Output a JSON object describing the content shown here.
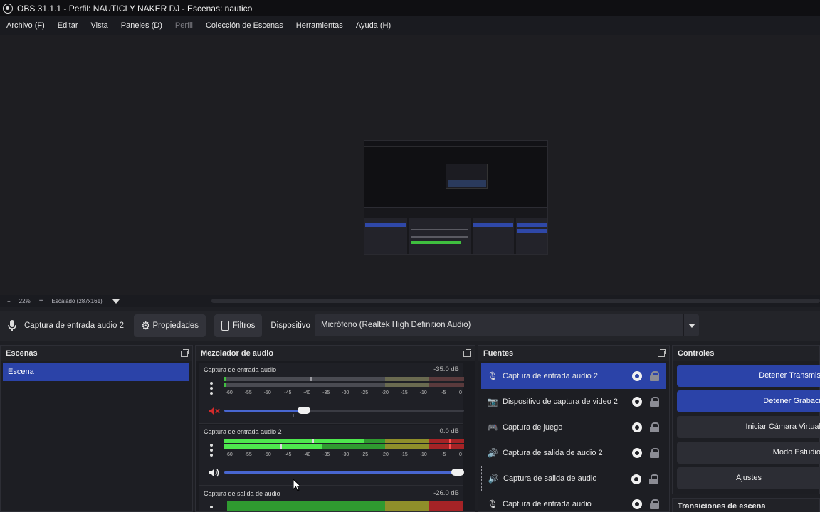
{
  "window": {
    "title": "OBS 31.1.1 - Perfil: NAUTICI Y NAKER DJ - Escenas: nautico"
  },
  "menu": [
    "Archivo (F)",
    "Editar",
    "Vista",
    "Paneles (D)",
    "Perfil",
    "Colección de Escenas",
    "Herramientas",
    "Ayuda (H)"
  ],
  "zoombar": {
    "minus": "−",
    "zoom": "22%",
    "plus": "+",
    "scaling": "Escalado (287x161)"
  },
  "properties_bar": {
    "source_name": "Captura de entrada audio 2",
    "properties_label": "Propiedades",
    "filters_label": "Filtros",
    "device_label": "Dispositivo",
    "device_value": "Micrófono (Realtek High Definition Audio)"
  },
  "scenes": {
    "title": "Escenas",
    "items": [
      "Escena"
    ]
  },
  "mixer": {
    "title": "Mezclador de audio",
    "scale": [
      "-60",
      "-55",
      "-50",
      "-45",
      "-40",
      "-35",
      "-30",
      "-25",
      "-20",
      "-15",
      "-10",
      "-5",
      "0"
    ],
    "channels": [
      {
        "name": "Captura de entrada audio",
        "db": "-35.0 dB",
        "muted": true,
        "volume_level": 0.33
      },
      {
        "name": "Captura de entrada audio 2",
        "db": "0.0 dB",
        "muted": false,
        "volume_level": 1.0
      },
      {
        "name": "Captura de salida de audio",
        "db": "-26.0 dB",
        "muted": false
      }
    ]
  },
  "sources": {
    "title": "Fuentes",
    "items": [
      {
        "label": "Captura de entrada audio 2",
        "icon": "microphone-icon"
      },
      {
        "label": "Dispositivo de captura de video 2",
        "icon": "camera-icon"
      },
      {
        "label": "Captura de juego",
        "icon": "gamepad-icon"
      },
      {
        "label": "Captura de salida de audio 2",
        "icon": "speaker-icon"
      },
      {
        "label": "Captura de salida de audio",
        "icon": "speaker-icon"
      },
      {
        "label": "Captura de entrada audio",
        "icon": "microphone-icon"
      }
    ]
  },
  "controls": {
    "title": "Controles",
    "buttons": [
      "Detener Transmis",
      "Detener Grabaci",
      "Iniciar Cámara Virtual",
      "Modo Estudio",
      "Ajustes"
    ]
  },
  "transitions": {
    "title": "Transiciones de escena"
  },
  "colors": {
    "accent": "#2b43a8",
    "meter_green": "#3fbf3f",
    "meter_yellow": "#a0a032",
    "meter_red": "#b8282c",
    "muted_red": "#d22b2b"
  }
}
